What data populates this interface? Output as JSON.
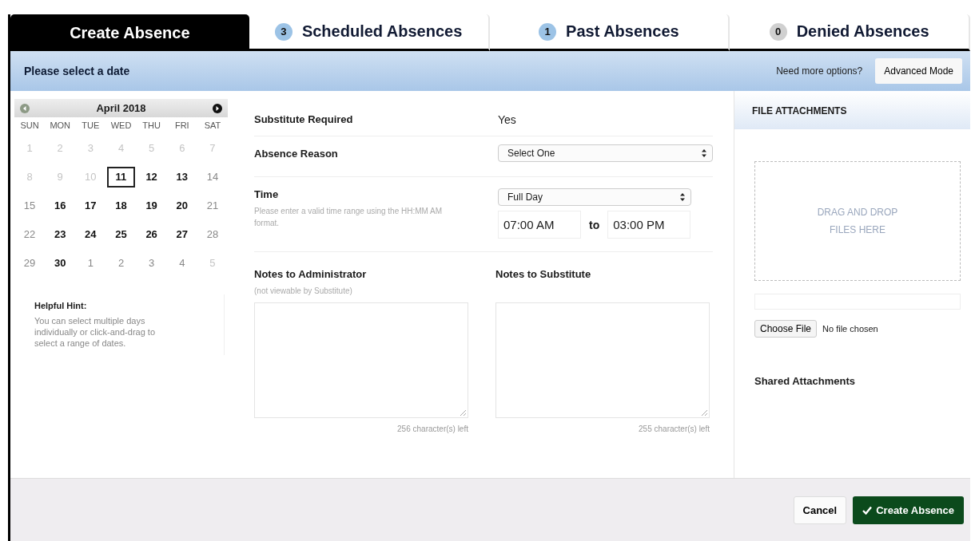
{
  "tabs": [
    {
      "label": "Create Absence",
      "selected": true
    },
    {
      "label": "Scheduled Absences",
      "count": "3",
      "color": "#9cc3e6",
      "selected": false
    },
    {
      "label": "Past Absences",
      "count": "1",
      "color": "#9cc3e6",
      "selected": false
    },
    {
      "label": "Denied Absences",
      "count": "0",
      "color": "#d0d0d0",
      "selected": false
    }
  ],
  "header": {
    "title": "Please select a date",
    "prompt": "Need more options?",
    "button": "Advanced Mode"
  },
  "calendar": {
    "month": "April 2018",
    "weekdays": [
      "SUN",
      "MON",
      "TUE",
      "WED",
      "THU",
      "FRI",
      "SAT"
    ],
    "days": [
      {
        "label": "1",
        "kind": "faint",
        "selected": false
      },
      {
        "label": "2",
        "kind": "faint",
        "selected": false
      },
      {
        "label": "3",
        "kind": "faint",
        "selected": false
      },
      {
        "label": "4",
        "kind": "faint",
        "selected": false
      },
      {
        "label": "5",
        "kind": "faint",
        "selected": false
      },
      {
        "label": "6",
        "kind": "faint",
        "selected": false
      },
      {
        "label": "7",
        "kind": "faint",
        "selected": false
      },
      {
        "label": "8",
        "kind": "faint",
        "selected": false
      },
      {
        "label": "9",
        "kind": "faint",
        "selected": false
      },
      {
        "label": "10",
        "kind": "faint",
        "selected": false
      },
      {
        "label": "11",
        "kind": "bold",
        "selected": true
      },
      {
        "label": "12",
        "kind": "bold",
        "selected": false
      },
      {
        "label": "13",
        "kind": "bold",
        "selected": false
      },
      {
        "label": "14",
        "kind": "plain",
        "selected": false
      },
      {
        "label": "15",
        "kind": "plain",
        "selected": false
      },
      {
        "label": "16",
        "kind": "bold",
        "selected": false
      },
      {
        "label": "17",
        "kind": "bold",
        "selected": false
      },
      {
        "label": "18",
        "kind": "bold",
        "selected": false
      },
      {
        "label": "19",
        "kind": "bold",
        "selected": false
      },
      {
        "label": "20",
        "kind": "bold",
        "selected": false
      },
      {
        "label": "21",
        "kind": "plain",
        "selected": false
      },
      {
        "label": "22",
        "kind": "plain",
        "selected": false
      },
      {
        "label": "23",
        "kind": "bold",
        "selected": false
      },
      {
        "label": "24",
        "kind": "bold",
        "selected": false
      },
      {
        "label": "25",
        "kind": "bold",
        "selected": false
      },
      {
        "label": "26",
        "kind": "bold",
        "selected": false
      },
      {
        "label": "27",
        "kind": "bold",
        "selected": false
      },
      {
        "label": "28",
        "kind": "plain",
        "selected": false
      },
      {
        "label": "29",
        "kind": "plain",
        "selected": false
      },
      {
        "label": "30",
        "kind": "bold",
        "selected": false
      },
      {
        "label": "1",
        "kind": "plain",
        "selected": false
      },
      {
        "label": "2",
        "kind": "plain",
        "selected": false
      },
      {
        "label": "3",
        "kind": "plain",
        "selected": false
      },
      {
        "label": "4",
        "kind": "plain",
        "selected": false
      },
      {
        "label": "5",
        "kind": "faint",
        "selected": false
      }
    ],
    "hint_title": "Helpful Hint:",
    "hint": "You can select multiple days individually or click-and-drag to select a range of dates."
  },
  "form": {
    "substitute_label": "Substitute Required",
    "substitute_value": "Yes",
    "reason_label": "Absence Reason",
    "reason_value": "Select One",
    "time_label": "Time",
    "time_help": "Please enter a valid time range using the HH:MM AM format.",
    "time_mode": "Full Day",
    "start": "07:00 AM",
    "to": "to",
    "end": "03:00 PM",
    "notes": [
      {
        "label": "Notes to Administrator",
        "sub": "(not viewable by Substitute)",
        "remaining": "256 character(s) left"
      },
      {
        "label": "Notes to Substitute",
        "remaining": "255 character(s) left"
      }
    ]
  },
  "attachments": {
    "title": "FILE ATTACHMENTS",
    "drop": "DRAG AND DROP FILES HERE",
    "choose": "Choose File",
    "chosen": "No file chosen",
    "shared": "Shared Attachments"
  },
  "footer": {
    "cancel": "Cancel",
    "submit": "Create Absence"
  }
}
